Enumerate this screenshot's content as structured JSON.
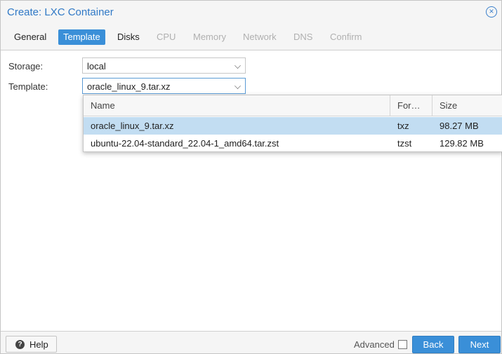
{
  "window": {
    "title": "Create: LXC Container",
    "close_icon": "close-circle-icon",
    "accent_color": "#3a8fd8"
  },
  "tabs": [
    {
      "label": "General",
      "state": "enabled"
    },
    {
      "label": "Template",
      "state": "active"
    },
    {
      "label": "Disks",
      "state": "enabled"
    },
    {
      "label": "CPU",
      "state": "disabled"
    },
    {
      "label": "Memory",
      "state": "disabled"
    },
    {
      "label": "Network",
      "state": "disabled"
    },
    {
      "label": "DNS",
      "state": "disabled"
    },
    {
      "label": "Confirm",
      "state": "disabled"
    }
  ],
  "form": {
    "storage_label": "Storage:",
    "storage_value": "local",
    "template_label": "Template:",
    "template_value": "oracle_linux_9.tar.xz"
  },
  "template_picker": {
    "columns": [
      "Name",
      "For…",
      "Size"
    ],
    "rows": [
      {
        "name": "oracle_linux_9.tar.xz",
        "format": "txz",
        "size": "98.27 MB",
        "selected": true
      },
      {
        "name": "ubuntu-22.04-standard_22.04-1_amd64.tar.zst",
        "format": "tzst",
        "size": "129.82 MB",
        "selected": false
      }
    ]
  },
  "footer": {
    "help_label": "Help",
    "help_icon": "question-circle-icon",
    "advanced_label": "Advanced",
    "advanced_checked": false,
    "back_label": "Back",
    "next_label": "Next"
  }
}
